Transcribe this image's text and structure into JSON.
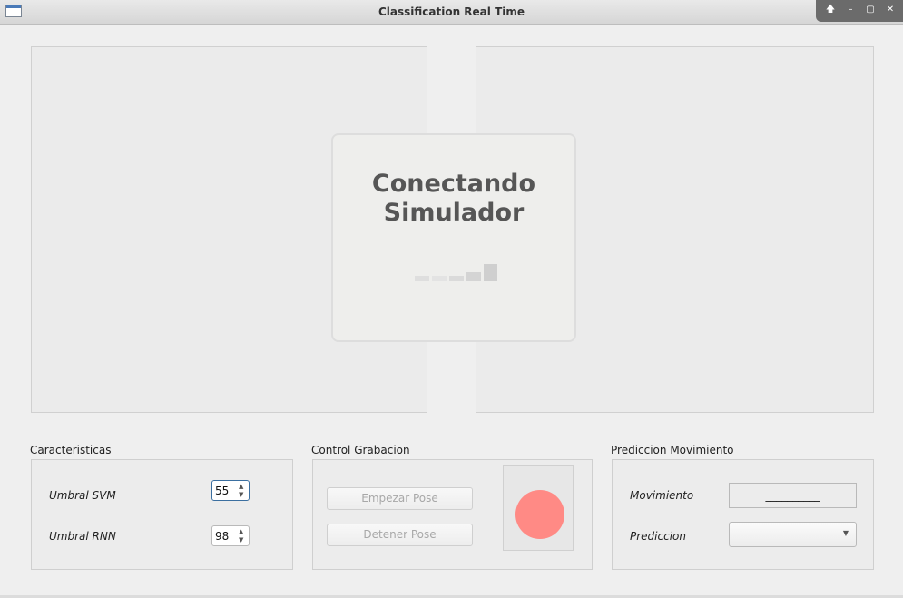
{
  "window": {
    "title": "Classification Real Time",
    "controls": {
      "up": "🡅",
      "minimize": "–",
      "maximize": "▢",
      "close": "✕"
    }
  },
  "overlay": {
    "title": "Conectando\nSimulador"
  },
  "caracteristicas": {
    "label": "Caracteristicas",
    "umbral_svm_label": "Umbral SVM",
    "umbral_svm_value": "55",
    "umbral_rnn_label": "Umbral RNN",
    "umbral_rnn_value": "98"
  },
  "control": {
    "label": "Control Grabacion",
    "start_button": "Empezar Pose",
    "stop_button": "Detener Pose",
    "indicator_color": "#ff8a85"
  },
  "prediccion": {
    "label": "Prediccion Movimiento",
    "movimiento_label": "Movimiento",
    "movimiento_value": "__________",
    "prediccion_label": "Prediccion",
    "prediccion_value": ""
  }
}
